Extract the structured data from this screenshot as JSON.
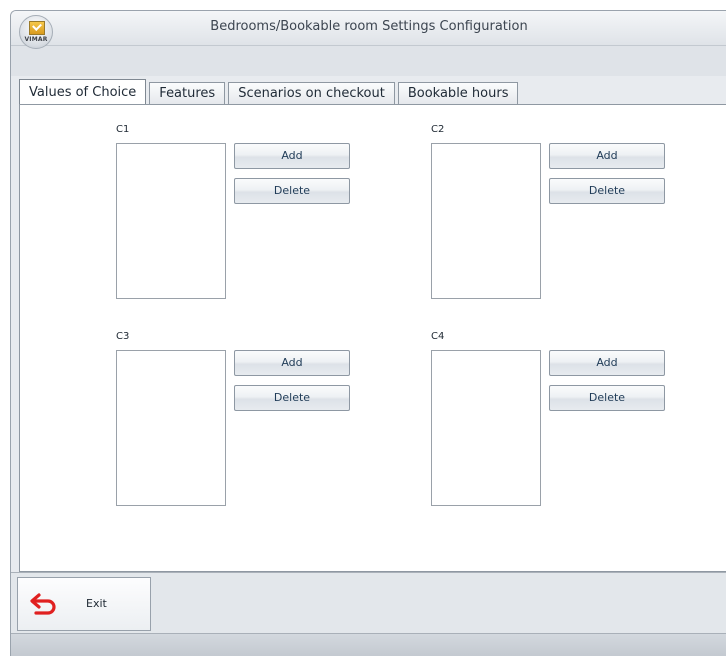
{
  "window": {
    "title": "Bedrooms/Bookable room Settings Configuration",
    "logo_text": "VIMAR"
  },
  "tabs": [
    {
      "label": "Values of Choice",
      "active": true
    },
    {
      "label": "Features",
      "active": false
    },
    {
      "label": "Scenarios on checkout",
      "active": false
    },
    {
      "label": "Bookable hours",
      "active": false
    }
  ],
  "groups": {
    "c1": {
      "label": "C1",
      "add_label": "Add",
      "delete_label": "Delete"
    },
    "c2": {
      "label": "C2",
      "add_label": "Add",
      "delete_label": "Delete"
    },
    "c3": {
      "label": "C3",
      "add_label": "Add",
      "delete_label": "Delete"
    },
    "c4": {
      "label": "C4",
      "add_label": "Add",
      "delete_label": "Delete"
    }
  },
  "footer": {
    "exit_label": "Exit",
    "exit_icon": "undo-arrow-icon",
    "exit_icon_color": "#e02020"
  },
  "colors": {
    "tab_text": "#1f2a36",
    "button_text": "#1f3b57"
  }
}
